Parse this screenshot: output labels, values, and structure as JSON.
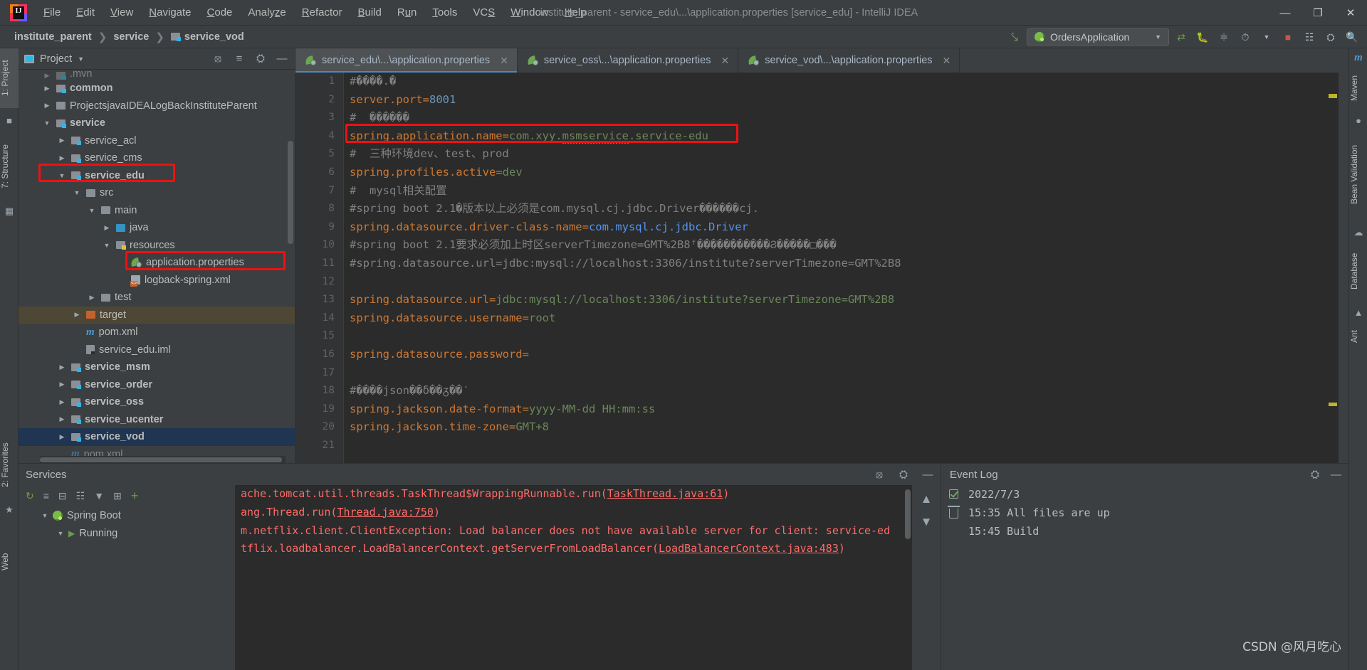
{
  "window": {
    "title": "institute_parent - service_edu\\...\\application.properties [service_edu] - IntelliJ IDEA",
    "minimize": "—",
    "maximize": "❐",
    "close": "✕"
  },
  "menu": [
    {
      "label": "File"
    },
    {
      "label": "Edit"
    },
    {
      "label": "View"
    },
    {
      "label": "Navigate"
    },
    {
      "label": "Code"
    },
    {
      "label": "Analyze"
    },
    {
      "label": "Refactor"
    },
    {
      "label": "Build"
    },
    {
      "label": "Run"
    },
    {
      "label": "Tools"
    },
    {
      "label": "VCS"
    },
    {
      "label": "Window"
    },
    {
      "label": "Help"
    }
  ],
  "breadcrumb": {
    "items": [
      "institute_parent",
      "service",
      "service_vod"
    ],
    "separator": "❯"
  },
  "toolbar": {
    "run_config": "OrdersApplication",
    "caret": "▼",
    "icons": [
      "build-hammer-icon",
      "sync-icon",
      "debug-icon",
      "coverage-icon",
      "profile-icon",
      "stop-icon",
      "layout-icon",
      "settings-icon",
      "search-icon"
    ]
  },
  "left_strip": {
    "tabs": [
      "1: Project",
      "7: Structure",
      "2: Favorites",
      "Web"
    ]
  },
  "right_strip": {
    "tabs": [
      "m Maven",
      "Bean Validation",
      "Database",
      "Ant"
    ]
  },
  "project_panel": {
    "title": "Project",
    "caret": "▼",
    "buttons": [
      "locate-icon",
      "collapse-all-icon",
      "settings-icon",
      "hide-icon"
    ],
    "tree": [
      {
        "indent": 1,
        "arrow": "▶",
        "icon": "folder-module",
        "label": ".mvn",
        "bold": false,
        "clipped": true
      },
      {
        "indent": 1,
        "arrow": "▶",
        "icon": "folder-module",
        "label": "common",
        "bold": true
      },
      {
        "indent": 1,
        "arrow": "▶",
        "icon": "folder-plain",
        "label": "ProjectsjavaIDEALogBackInstituteParent",
        "bold": false
      },
      {
        "indent": 1,
        "arrow": "▼",
        "icon": "folder-module",
        "label": "service",
        "bold": true
      },
      {
        "indent": 2,
        "arrow": "▶",
        "icon": "folder-module",
        "label": "service_acl",
        "bold": false
      },
      {
        "indent": 2,
        "arrow": "▶",
        "icon": "folder-module",
        "label": "service_cms",
        "bold": false
      },
      {
        "indent": 2,
        "arrow": "▼",
        "icon": "folder-module",
        "label": "service_edu",
        "bold": true,
        "highlight": "red-box"
      },
      {
        "indent": 3,
        "arrow": "▼",
        "icon": "folder-plain",
        "label": "src",
        "bold": false
      },
      {
        "indent": 4,
        "arrow": "▼",
        "icon": "folder-plain",
        "label": "main",
        "bold": false
      },
      {
        "indent": 5,
        "arrow": "▶",
        "icon": "folder-blue",
        "label": "java",
        "bold": false
      },
      {
        "indent": 5,
        "arrow": "▼",
        "icon": "folder-resources",
        "label": "resources",
        "bold": false
      },
      {
        "indent": 6,
        "arrow": "",
        "icon": "spring-leaf",
        "label": "application.properties",
        "bold": false,
        "highlight": "red-box"
      },
      {
        "indent": 6,
        "arrow": "",
        "icon": "xml-file",
        "label": "logback-spring.xml",
        "bold": false
      },
      {
        "indent": 4,
        "arrow": "▶",
        "icon": "folder-plain",
        "label": "test",
        "bold": false
      },
      {
        "indent": 3,
        "arrow": "▶",
        "icon": "folder-orange",
        "label": "target",
        "bold": false,
        "row_highlight": true
      },
      {
        "indent": 3,
        "arrow": "",
        "icon": "maven-m",
        "label": "pom.xml",
        "bold": false
      },
      {
        "indent": 3,
        "arrow": "",
        "icon": "iml-file",
        "label": "service_edu.iml",
        "bold": false
      },
      {
        "indent": 2,
        "arrow": "▶",
        "icon": "folder-module",
        "label": "service_msm",
        "bold": true
      },
      {
        "indent": 2,
        "arrow": "▶",
        "icon": "folder-module",
        "label": "service_order",
        "bold": true
      },
      {
        "indent": 2,
        "arrow": "▶",
        "icon": "folder-module",
        "label": "service_oss",
        "bold": true
      },
      {
        "indent": 2,
        "arrow": "▶",
        "icon": "folder-module",
        "label": "service_ucenter",
        "bold": true
      },
      {
        "indent": 2,
        "arrow": "▶",
        "icon": "folder-module",
        "label": "service_vod",
        "bold": true,
        "selected": true
      },
      {
        "indent": 2,
        "arrow": "",
        "icon": "maven-m",
        "label": "pom.xml",
        "bold": false,
        "clipped": true
      }
    ]
  },
  "editor": {
    "tabs": [
      {
        "label": "service_edu\\...\\application.properties",
        "active": true,
        "icon": "spring-leaf",
        "close": "✕"
      },
      {
        "label": "service_oss\\...\\application.properties",
        "active": false,
        "icon": "spring-leaf",
        "close": "✕"
      },
      {
        "label": "service_vod\\...\\application.properties",
        "active": false,
        "icon": "spring-leaf",
        "close": "✕"
      }
    ],
    "lines": [
      {
        "no": 1,
        "segs": [
          {
            "t": "#����.�",
            "c": "c"
          }
        ]
      },
      {
        "no": 2,
        "segs": [
          {
            "t": "server.port",
            "c": "k"
          },
          {
            "t": "=",
            "c": "k"
          },
          {
            "t": "8001",
            "c": "n"
          }
        ]
      },
      {
        "no": 3,
        "segs": [
          {
            "t": "#  ������",
            "c": "c"
          }
        ]
      },
      {
        "no": 4,
        "segs": [
          {
            "t": "spring.application.name",
            "c": "k"
          },
          {
            "t": "=",
            "c": "k"
          },
          {
            "t": "com.xyy.",
            "c": "v"
          },
          {
            "t": "msmservice",
            "c": "v wavy"
          },
          {
            "t": ".service-edu",
            "c": "v"
          }
        ],
        "highlight": "red-box"
      },
      {
        "no": 5,
        "segs": [
          {
            "t": "#  三种环境dev、test、prod",
            "c": "c"
          }
        ]
      },
      {
        "no": 6,
        "segs": [
          {
            "t": "spring.profiles.active",
            "c": "k"
          },
          {
            "t": "=",
            "c": "k"
          },
          {
            "t": "dev",
            "c": "v"
          }
        ]
      },
      {
        "no": 7,
        "segs": [
          {
            "t": "#  mysql相关配置",
            "c": "c"
          }
        ]
      },
      {
        "no": 8,
        "segs": [
          {
            "t": "#spring boot 2.1�版本以上必须是com.mysql.cj.jdbc.Driver������cj.",
            "c": "c"
          }
        ]
      },
      {
        "no": 9,
        "segs": [
          {
            "t": "spring.datasource.driver-class-name",
            "c": "k"
          },
          {
            "t": "=",
            "c": "k"
          },
          {
            "t": "com.mysql.cj.jdbc.Driver",
            "c": "cyan"
          }
        ]
      },
      {
        "no": 10,
        "segs": [
          {
            "t": "#spring boot 2.1要求必须加上时区serverTimezone=GMT%2B8ᶠ�����������Ϩ�����□���",
            "c": "c"
          }
        ]
      },
      {
        "no": 11,
        "segs": [
          {
            "t": "#spring.datasource.url=jdbc:mysql://localhost:3306/institute?serverTimezone=GMT%2B8",
            "c": "c"
          }
        ]
      },
      {
        "no": 12,
        "segs": [
          {
            "t": "",
            "c": "c"
          }
        ]
      },
      {
        "no": 13,
        "segs": [
          {
            "t": "spring.datasource.url",
            "c": "k"
          },
          {
            "t": "=",
            "c": "k"
          },
          {
            "t": "jdbc:mysql://localhost:3306/institute?serverTimezone=GMT%2B8",
            "c": "v"
          }
        ]
      },
      {
        "no": 14,
        "segs": [
          {
            "t": "spring.datasource.username",
            "c": "k"
          },
          {
            "t": "=",
            "c": "k"
          },
          {
            "t": "root",
            "c": "v"
          }
        ]
      },
      {
        "no": 15,
        "segs": [
          {
            "t": "",
            "c": "c"
          }
        ]
      },
      {
        "no": 16,
        "segs": [
          {
            "t": "spring.datasource.password",
            "c": "k"
          },
          {
            "t": "=",
            "c": "k"
          }
        ]
      },
      {
        "no": 17,
        "segs": [
          {
            "t": "",
            "c": "c"
          }
        ]
      },
      {
        "no": 18,
        "segs": [
          {
            "t": "#����json��δ��ᵹ��‵",
            "c": "c"
          }
        ]
      },
      {
        "no": 19,
        "segs": [
          {
            "t": "spring.jackson.date-format",
            "c": "k"
          },
          {
            "t": "=",
            "c": "k"
          },
          {
            "t": "yyyy-MM-dd HH:mm:ss",
            "c": "v"
          }
        ]
      },
      {
        "no": 20,
        "segs": [
          {
            "t": "spring.jackson.time-zone",
            "c": "k"
          },
          {
            "t": "=",
            "c": "k"
          },
          {
            "t": "GMT+8",
            "c": "v"
          }
        ]
      },
      {
        "no": 21,
        "segs": [
          {
            "t": "",
            "c": "c"
          }
        ]
      }
    ]
  },
  "services": {
    "title": "Services",
    "header_icons": [
      "locate-icon",
      "settings-icon",
      "hide-icon"
    ],
    "toolbar_icons": [
      "rerun-icon",
      "expand-icon",
      "collapse-icon",
      "group-icon",
      "filter-icon",
      "new-tab-icon",
      "add-icon"
    ],
    "tree": [
      {
        "indent": 0,
        "arrow": "▼",
        "icon": "spring-boot-icon",
        "label": "Spring Boot"
      },
      {
        "indent": 1,
        "arrow": "▼",
        "icon": "run-icon",
        "label": "Running"
      }
    ],
    "console": [
      "ache.tomcat.util.threads.TaskThread$WrappingRunnable.run(TaskThread.java:61)",
      "ang.Thread.run(Thread.java:750)",
      "m.netflix.client.ClientException: Load balancer does not have available server for client: service-ed",
      "tflix.loadbalancer.LoadBalancerContext.getServerFromLoadBalancer(LoadBalancerContext.java:483)"
    ],
    "console_links": [
      "TaskThread.java:61",
      "Thread.java:750",
      "LoadBalancerContext.java:483"
    ],
    "arrows": [
      "▲",
      "▼"
    ]
  },
  "event_log": {
    "title": "Event Log",
    "header_icons": [
      "settings-icon",
      "hide-icon"
    ],
    "side_icons": [
      "mark-read-icon",
      "delete-icon"
    ],
    "date": "2022/7/3",
    "time": "15:35",
    "message": "All files are up",
    "message2": "15:45  Build",
    "watermark": "CSDN @风月吃心"
  }
}
